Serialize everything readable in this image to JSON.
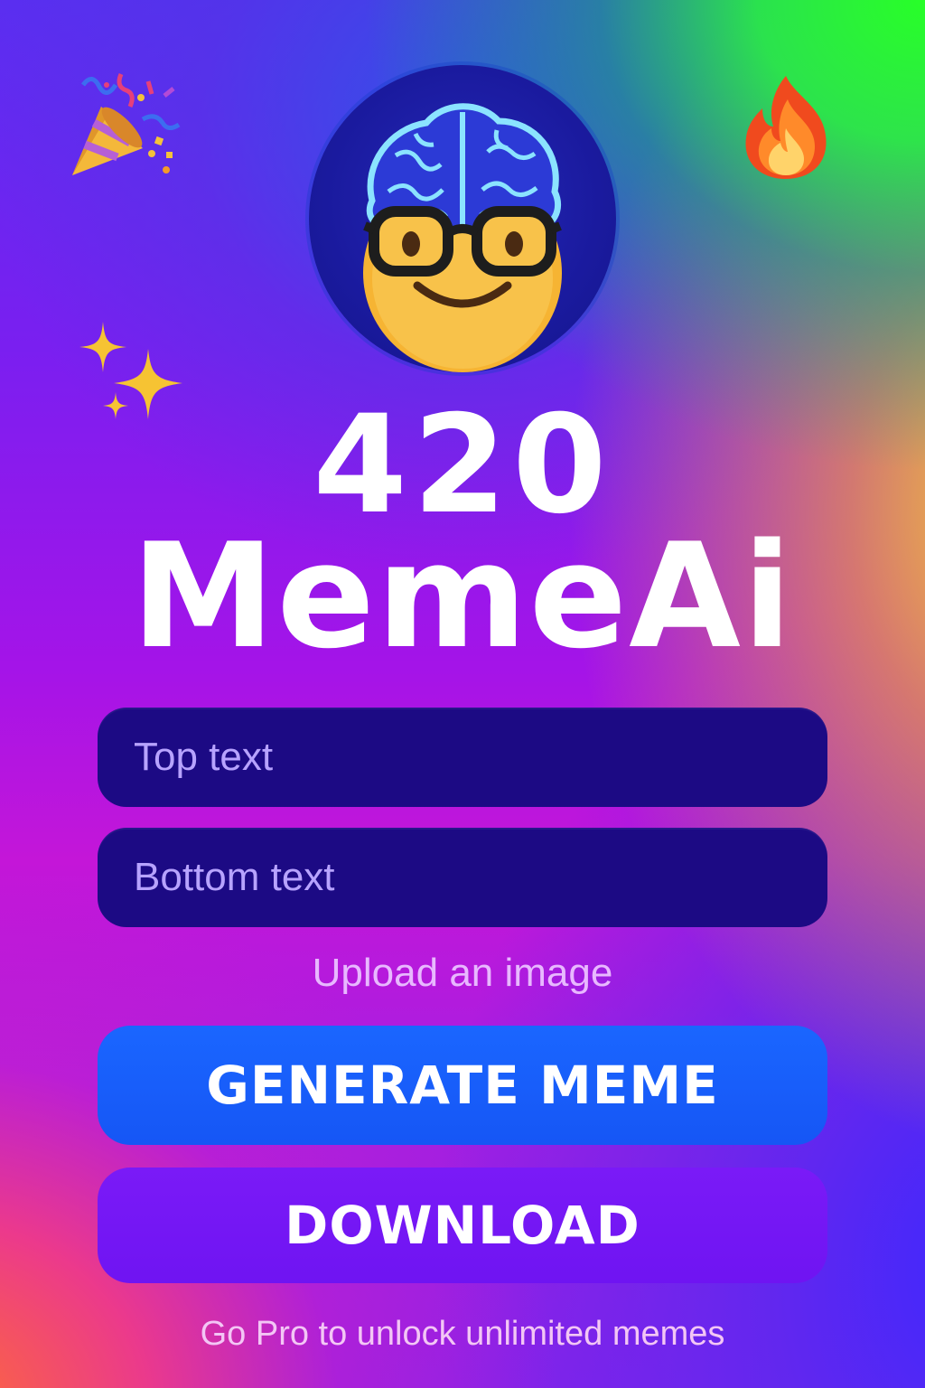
{
  "app": {
    "title_line1": "420",
    "title_line2": "MemeAi"
  },
  "avatar": {
    "icon": "nerd-brain-face-icon"
  },
  "decorations": {
    "top_left": "party-popper-icon",
    "top_right": "fire-icon",
    "left": "sparkles-icon"
  },
  "form": {
    "top_text": {
      "value": "",
      "placeholder": "Top text"
    },
    "bottom_text": {
      "value": "",
      "placeholder": "Bottom text"
    },
    "upload_label": "Upload an image"
  },
  "actions": {
    "generate_label": "GENERATE MEME",
    "download_label": "DOWNLOAD"
  },
  "footer": {
    "promo": "Go Pro to unlock unlimited memes"
  },
  "colors": {
    "field_bg": "#1c0a84",
    "generate_bg": "#1a66ff",
    "download_bg": "#7a1af7",
    "avatar_bg": "#1a1a9e"
  }
}
